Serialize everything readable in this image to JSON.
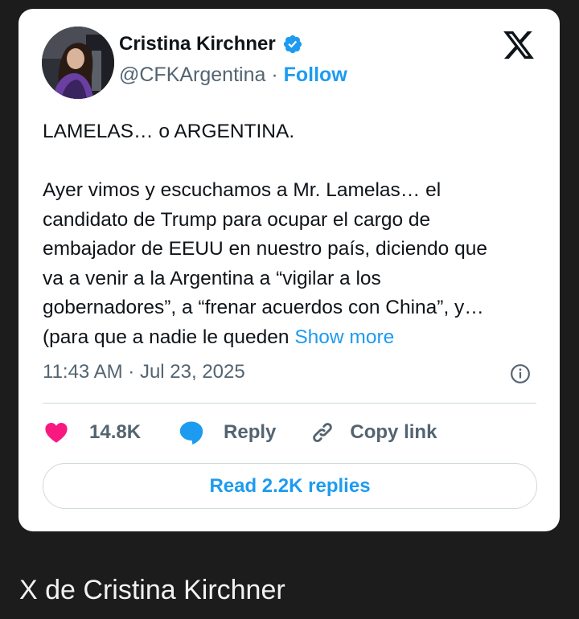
{
  "tweet": {
    "author_name": "Cristina Kirchner",
    "handle": "@CFKArgentina",
    "separator": " · ",
    "follow_label": "Follow",
    "text_headline": "LAMELAS… o ARGENTINA.",
    "text_lines": [
      "Ayer vimos y escuchamos a Mr. Lamelas… el",
      "candidato de Trump para ocupar el cargo de",
      "embajador de EEUU en nuestro país, diciendo que",
      "va a venir a la Argentina a “vigilar a los",
      "gobernadores”, a “frenar acuerdos con China”,  y…"
    ],
    "text_last_line": "(para que a nadie le queden ",
    "show_more_label": "Show more",
    "timestamp": "11:43 AM · Jul 23, 2025",
    "likes_count": "14.8K",
    "reply_label": "Reply",
    "copy_link_label": "Copy link",
    "read_replies_label": "Read 2.2K replies"
  },
  "caption": "X de Cristina Kirchner",
  "colors": {
    "accent": "#1d9bf0",
    "like": "#f91880",
    "text": "#0f1419",
    "muted": "#536471",
    "background": "#1c1c1c"
  },
  "icons": [
    "x-logo-icon",
    "verified-badge-icon",
    "info-icon",
    "heart-icon",
    "reply-bubble-icon",
    "link-icon"
  ]
}
